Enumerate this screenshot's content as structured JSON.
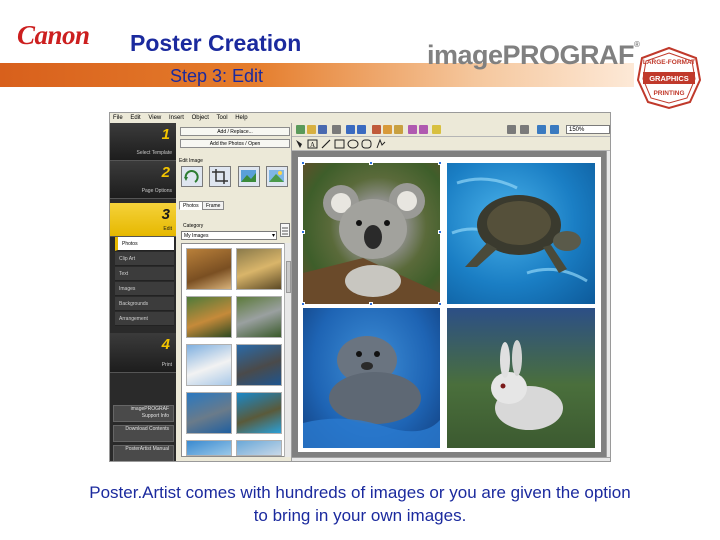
{
  "header": {
    "brand_logo": "Canon",
    "title": "Poster Creation",
    "subtitle": "Step 3: Edit",
    "product_brand_light": "image",
    "product_brand_bold": "PROGRAF",
    "trademark": "®",
    "badge_text": [
      "LARGE-FORMAT",
      "GRAPHICS",
      "PRINTING"
    ]
  },
  "app": {
    "menu": [
      "File",
      "Edit",
      "View",
      "Insert",
      "Object",
      "Tool",
      "Help"
    ],
    "steps": [
      {
        "number": "1",
        "label": "Select Template"
      },
      {
        "number": "2",
        "label": "Page Options"
      },
      {
        "number": "3",
        "label": "Edit"
      },
      {
        "number": "4",
        "label": "Print"
      }
    ],
    "edit_subitems": [
      "Photos",
      "Clip Art",
      "Text",
      "Images",
      "Backgrounds",
      "Arrangement"
    ],
    "nav_buttons": [
      "imagePROGRAF Support Info",
      "Download Contents",
      "PosterArtist Manual"
    ],
    "panel": {
      "add_replace_label": "Add / Replace...",
      "add_photos_label": "Add the Photos / Open",
      "edit_image_label": "Edit Image",
      "tabs": [
        "Photos",
        "Frame"
      ],
      "category_label": "Category",
      "category_value": "My Images"
    },
    "zoom_value": "150%",
    "colors": {
      "accent_yellow": "#e6b800",
      "nav_dark": "#2a2a2a",
      "selection_blue": "#2d6fdb"
    }
  },
  "caption": {
    "line1": "Poster.Artist comes with hundreds of images or you are given the option",
    "line2": "to bring in your own images."
  }
}
